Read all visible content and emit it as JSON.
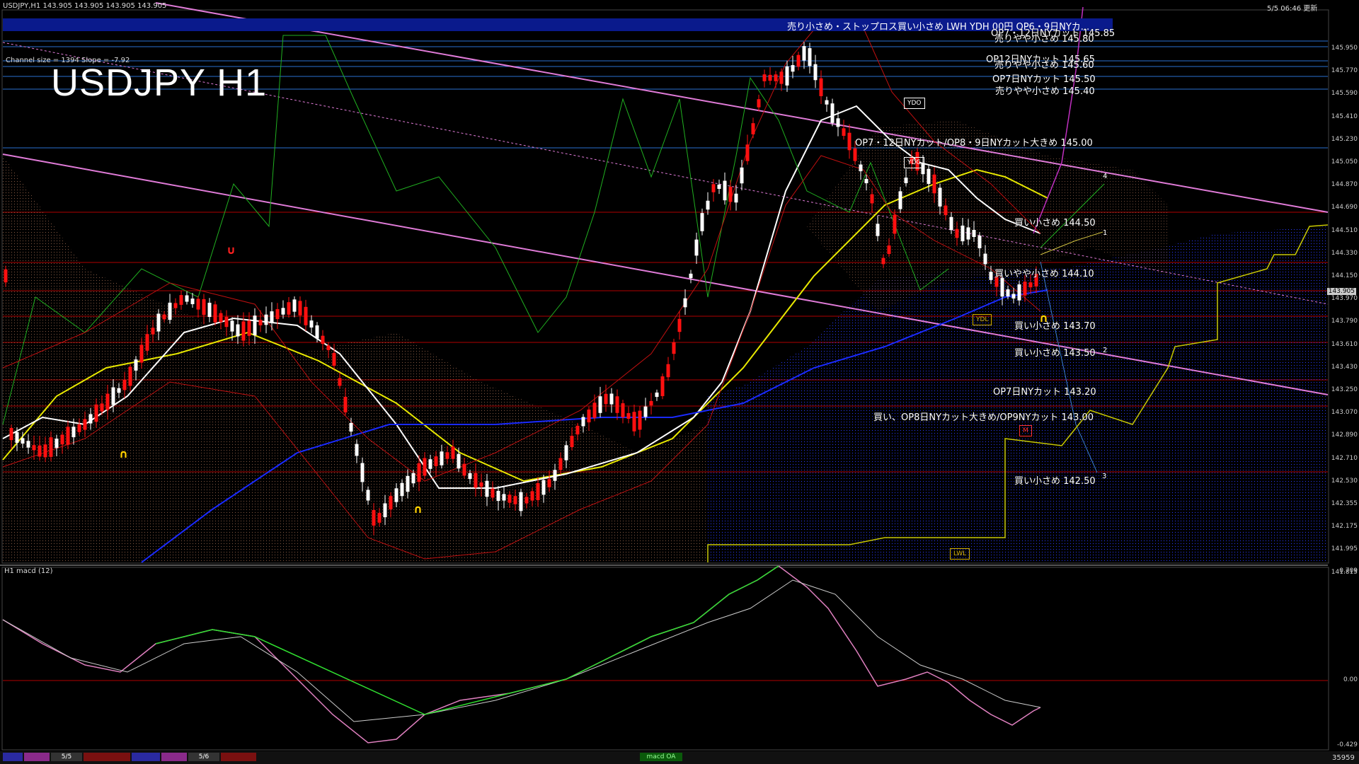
{
  "header": {
    "symbol_info": "USDJPY,H1  143.905 143.905 143.905 143.905",
    "update_time": "5/5 06:46 更新",
    "channel_info": "Channel size = 1394 Slope = -7.92"
  },
  "chart_title": "USDJPY H1",
  "banner_text": "売り小さめ・ストップロス買い小さめ  LWH  YDH 00円    OP6・9日NYカ...",
  "price_axis": [
    "145.950",
    "145.770",
    "145.590",
    "145.410",
    "145.230",
    "145.050",
    "144.870",
    "144.690",
    "144.510",
    "144.330",
    "144.150",
    "143.970",
    "143.790",
    "143.610",
    "143.430",
    "143.250",
    "143.070",
    "142.890",
    "142.710",
    "142.530",
    "142.355",
    "142.175",
    "141.995",
    "141.815"
  ],
  "current_price": "143.905",
  "levels": [
    {
      "label": "OP7・12日NYカット 145.85"
    },
    {
      "label": "売りやや小さめ 145.80"
    },
    {
      "label": "OP12日NYカット 145.65"
    },
    {
      "label": "売りやや小さめ 145.60"
    },
    {
      "label": "OP7日NYカット 145.50"
    },
    {
      "label": "売りやや小さめ 145.40"
    },
    {
      "label": "OP7・12日NYカット/OP8・9日NYカット大きめ 145.00"
    },
    {
      "label": "買い小さめ 144.50"
    },
    {
      "label": "買いやや小さめ 144.10"
    },
    {
      "label": "買い小さめ 143.70"
    },
    {
      "label": "買い小さめ 143.50"
    },
    {
      "label": "OP7日NYカット 143.20"
    },
    {
      "label": "買い、OP8日NYカット大きめ/OP9NYカット 143.00"
    },
    {
      "label": "買い小さめ 142.50"
    }
  ],
  "box_labels": {
    "ydo": "YDO",
    "ydc": "YDC",
    "ydl": "YDL",
    "lwl": "LWL",
    "m": "M"
  },
  "wave_numbers": [
    "1",
    "2",
    "3",
    "4"
  ],
  "macd": {
    "label": "H1  macd (12)",
    "max": "0.709",
    "zero": "0.00",
    "min": "-0.429"
  },
  "footer": {
    "tabs": [
      "5/5",
      "5/6"
    ],
    "center_label": "macd OA",
    "bar_count": "35959"
  },
  "colors": {
    "support": "#b00000",
    "resistance": "#2a6fd0",
    "channel": "#e07bd8",
    "banner": "#0a1a8c"
  }
}
